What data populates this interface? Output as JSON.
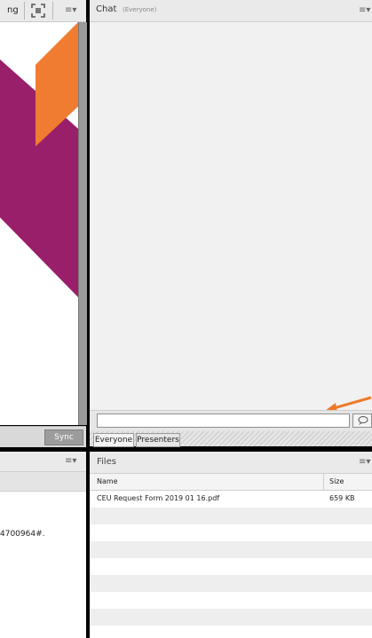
{
  "share_pod": {
    "title_fragment": "ng",
    "fullscreen_icon": "fullscreen-icon",
    "menu_icon": "menu-icon",
    "sync_label": "Sync"
  },
  "chat": {
    "title": "Chat",
    "scope": "(Everyone)",
    "menu_icon": "menu-icon",
    "input_value": "",
    "send_icon": "speech-bubble-icon",
    "tabs": [
      {
        "label": "Everyone"
      },
      {
        "label": "Presenters"
      }
    ]
  },
  "left_bottom_pod": {
    "menu_icon": "menu-icon",
    "text_fragment": "4700964#."
  },
  "files": {
    "title": "Files",
    "menu_icon": "menu-icon",
    "columns": {
      "name": "Name",
      "size": "Size"
    },
    "rows": [
      {
        "name": "CEU Request Form 2019 01 16.pdf",
        "size": "659 KB"
      }
    ]
  },
  "colors": {
    "slide_purple": "#9a1f6a",
    "slide_orange": "#f07c31",
    "annotation_arrow": "#ee7a2a"
  }
}
